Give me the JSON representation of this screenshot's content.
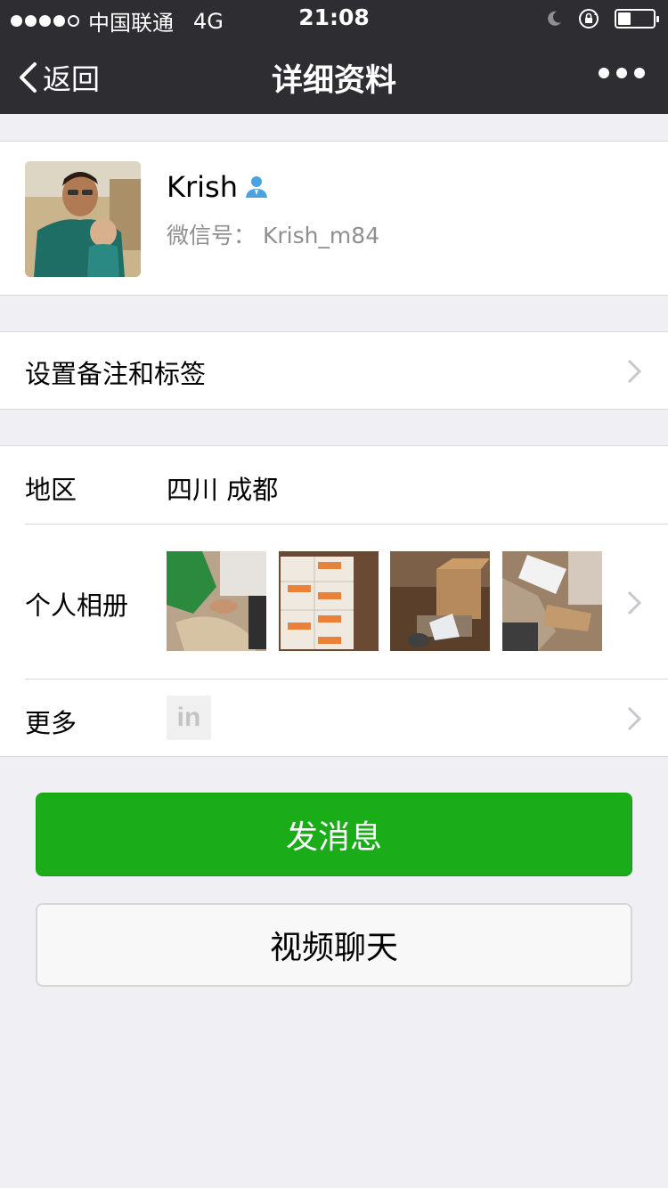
{
  "status_bar": {
    "carrier": "中国联通",
    "network": "4G",
    "time": "21:08",
    "signal_strength": 4,
    "signal_max": 5,
    "battery_level": 0.35
  },
  "nav": {
    "back_label": "返回",
    "title": "详细资料"
  },
  "profile": {
    "name": "Krish",
    "wechat_id": "微信号：  Krish_m84"
  },
  "remark_row": {
    "label": "设置备注和标签"
  },
  "region_row": {
    "label": "地区",
    "value": "四川 成都"
  },
  "album_row": {
    "label": "个人相册",
    "photo_count": 4
  },
  "more_row": {
    "label": "更多",
    "icon": "linkedin-icon",
    "icon_text": "in"
  },
  "buttons": {
    "send_message": "发消息",
    "video_chat": "视频聊天"
  },
  "colors": {
    "nav_bg": "#2e2e32",
    "accent_green": "#1aad19",
    "page_bg": "#efeff4"
  }
}
